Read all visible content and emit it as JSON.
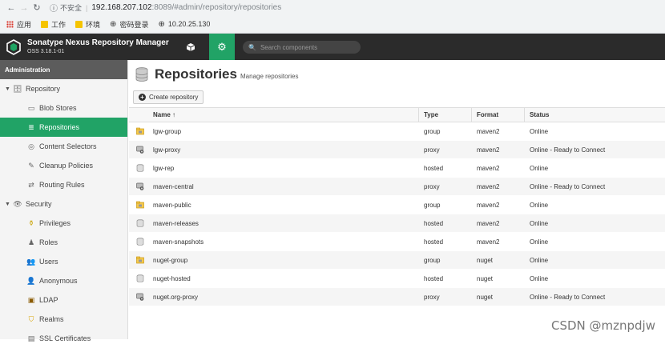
{
  "browser": {
    "info_label": "不安全",
    "url_host": "192.168.207.102",
    "url_path": ":8089/#admin/repository/repositories",
    "bookmarks": [
      {
        "label": "应用",
        "icon": "apps-grid-icon"
      },
      {
        "label": "工作",
        "icon": "folder-icon"
      },
      {
        "label": "环境",
        "icon": "folder-icon"
      },
      {
        "label": "密码登录",
        "icon": "globe-icon"
      },
      {
        "label": "10.20.25.130",
        "icon": "globe-icon"
      }
    ]
  },
  "header": {
    "title": "Sonatype Nexus Repository Manager",
    "version": "OSS 3.18.1-01",
    "search_placeholder": "Search components"
  },
  "sidebar": {
    "title": "Administration",
    "repository_group": "Repository",
    "repository_items": [
      "Blob Stores",
      "Repositories",
      "Content Selectors",
      "Cleanup Policies",
      "Routing Rules"
    ],
    "security_group": "Security",
    "security_items": [
      "Privileges",
      "Roles",
      "Users",
      "Anonymous",
      "LDAP",
      "Realms",
      "SSL Certificates"
    ]
  },
  "page": {
    "title": "Repositories",
    "subtitle": "Manage repositories",
    "create_label": "Create repository"
  },
  "table": {
    "headers": {
      "name": "Name ↑",
      "type": "Type",
      "format": "Format",
      "status": "Status"
    },
    "rows": [
      {
        "name": "lgw-group",
        "type": "group",
        "format": "maven2",
        "status": "Online",
        "icon": "group-repo-icon"
      },
      {
        "name": "lgw-proxy",
        "type": "proxy",
        "format": "maven2",
        "status": "Online - Ready to Connect",
        "icon": "proxy-repo-icon"
      },
      {
        "name": "lgw-rep",
        "type": "hosted",
        "format": "maven2",
        "status": "Online",
        "icon": "hosted-repo-icon"
      },
      {
        "name": "maven-central",
        "type": "proxy",
        "format": "maven2",
        "status": "Online - Ready to Connect",
        "icon": "proxy-repo-icon"
      },
      {
        "name": "maven-public",
        "type": "group",
        "format": "maven2",
        "status": "Online",
        "icon": "group-repo-icon"
      },
      {
        "name": "maven-releases",
        "type": "hosted",
        "format": "maven2",
        "status": "Online",
        "icon": "hosted-repo-icon"
      },
      {
        "name": "maven-snapshots",
        "type": "hosted",
        "format": "maven2",
        "status": "Online",
        "icon": "hosted-repo-icon"
      },
      {
        "name": "nuget-group",
        "type": "group",
        "format": "nuget",
        "status": "Online",
        "icon": "group-repo-icon"
      },
      {
        "name": "nuget-hosted",
        "type": "hosted",
        "format": "nuget",
        "status": "Online",
        "icon": "hosted-repo-icon"
      },
      {
        "name": "nuget.org-proxy",
        "type": "proxy",
        "format": "nuget",
        "status": "Online - Ready to Connect",
        "icon": "proxy-repo-icon"
      }
    ]
  },
  "watermark": "CSDN @mznpdjw",
  "colors": {
    "accent": "#21a366",
    "header_bg": "#2b2b2b",
    "sidebar_bg": "#f4f4f4"
  }
}
